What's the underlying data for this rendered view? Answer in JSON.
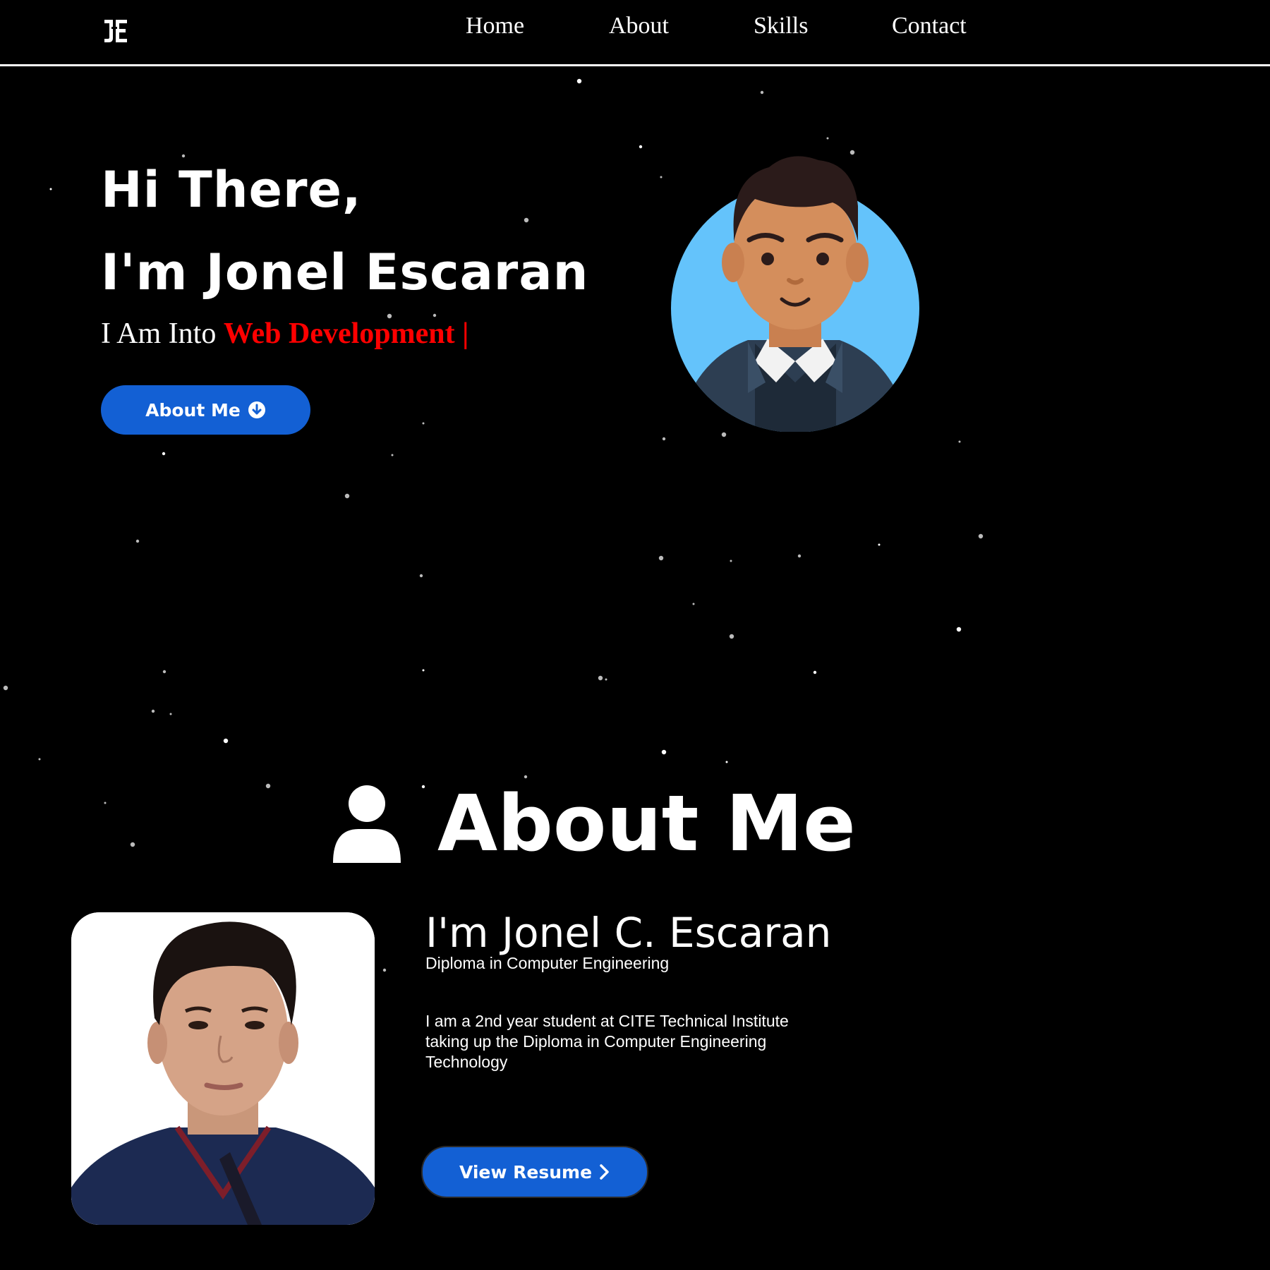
{
  "header": {
    "logo_text": "JE",
    "nav": [
      "Home",
      "About",
      "Skills",
      "Contact"
    ]
  },
  "hero": {
    "greeting": "Hi There,",
    "name_line": "I'm Jonel Escaran",
    "typed_prefix": "I Am Into",
    "typed_text": "Web Development |",
    "button_label": "About Me",
    "button_icon": "arrow-circle-down-icon"
  },
  "about": {
    "heading": "About Me",
    "heading_icon": "user-icon",
    "name": "I'm Jonel C. Escaran",
    "degree": "Diploma in Computer Engineering",
    "description": "I am a 2nd year student at CITE Technical Institute taking up the Diploma in Computer Engineering Technology",
    "resume_button_label": "View Resume",
    "resume_button_icon": "chevron-right-icon"
  },
  "colors": {
    "background": "#000000",
    "accent_text": "#ff0000",
    "button_blue": "#1360d4",
    "avatar_circle": "#64c3fb"
  }
}
